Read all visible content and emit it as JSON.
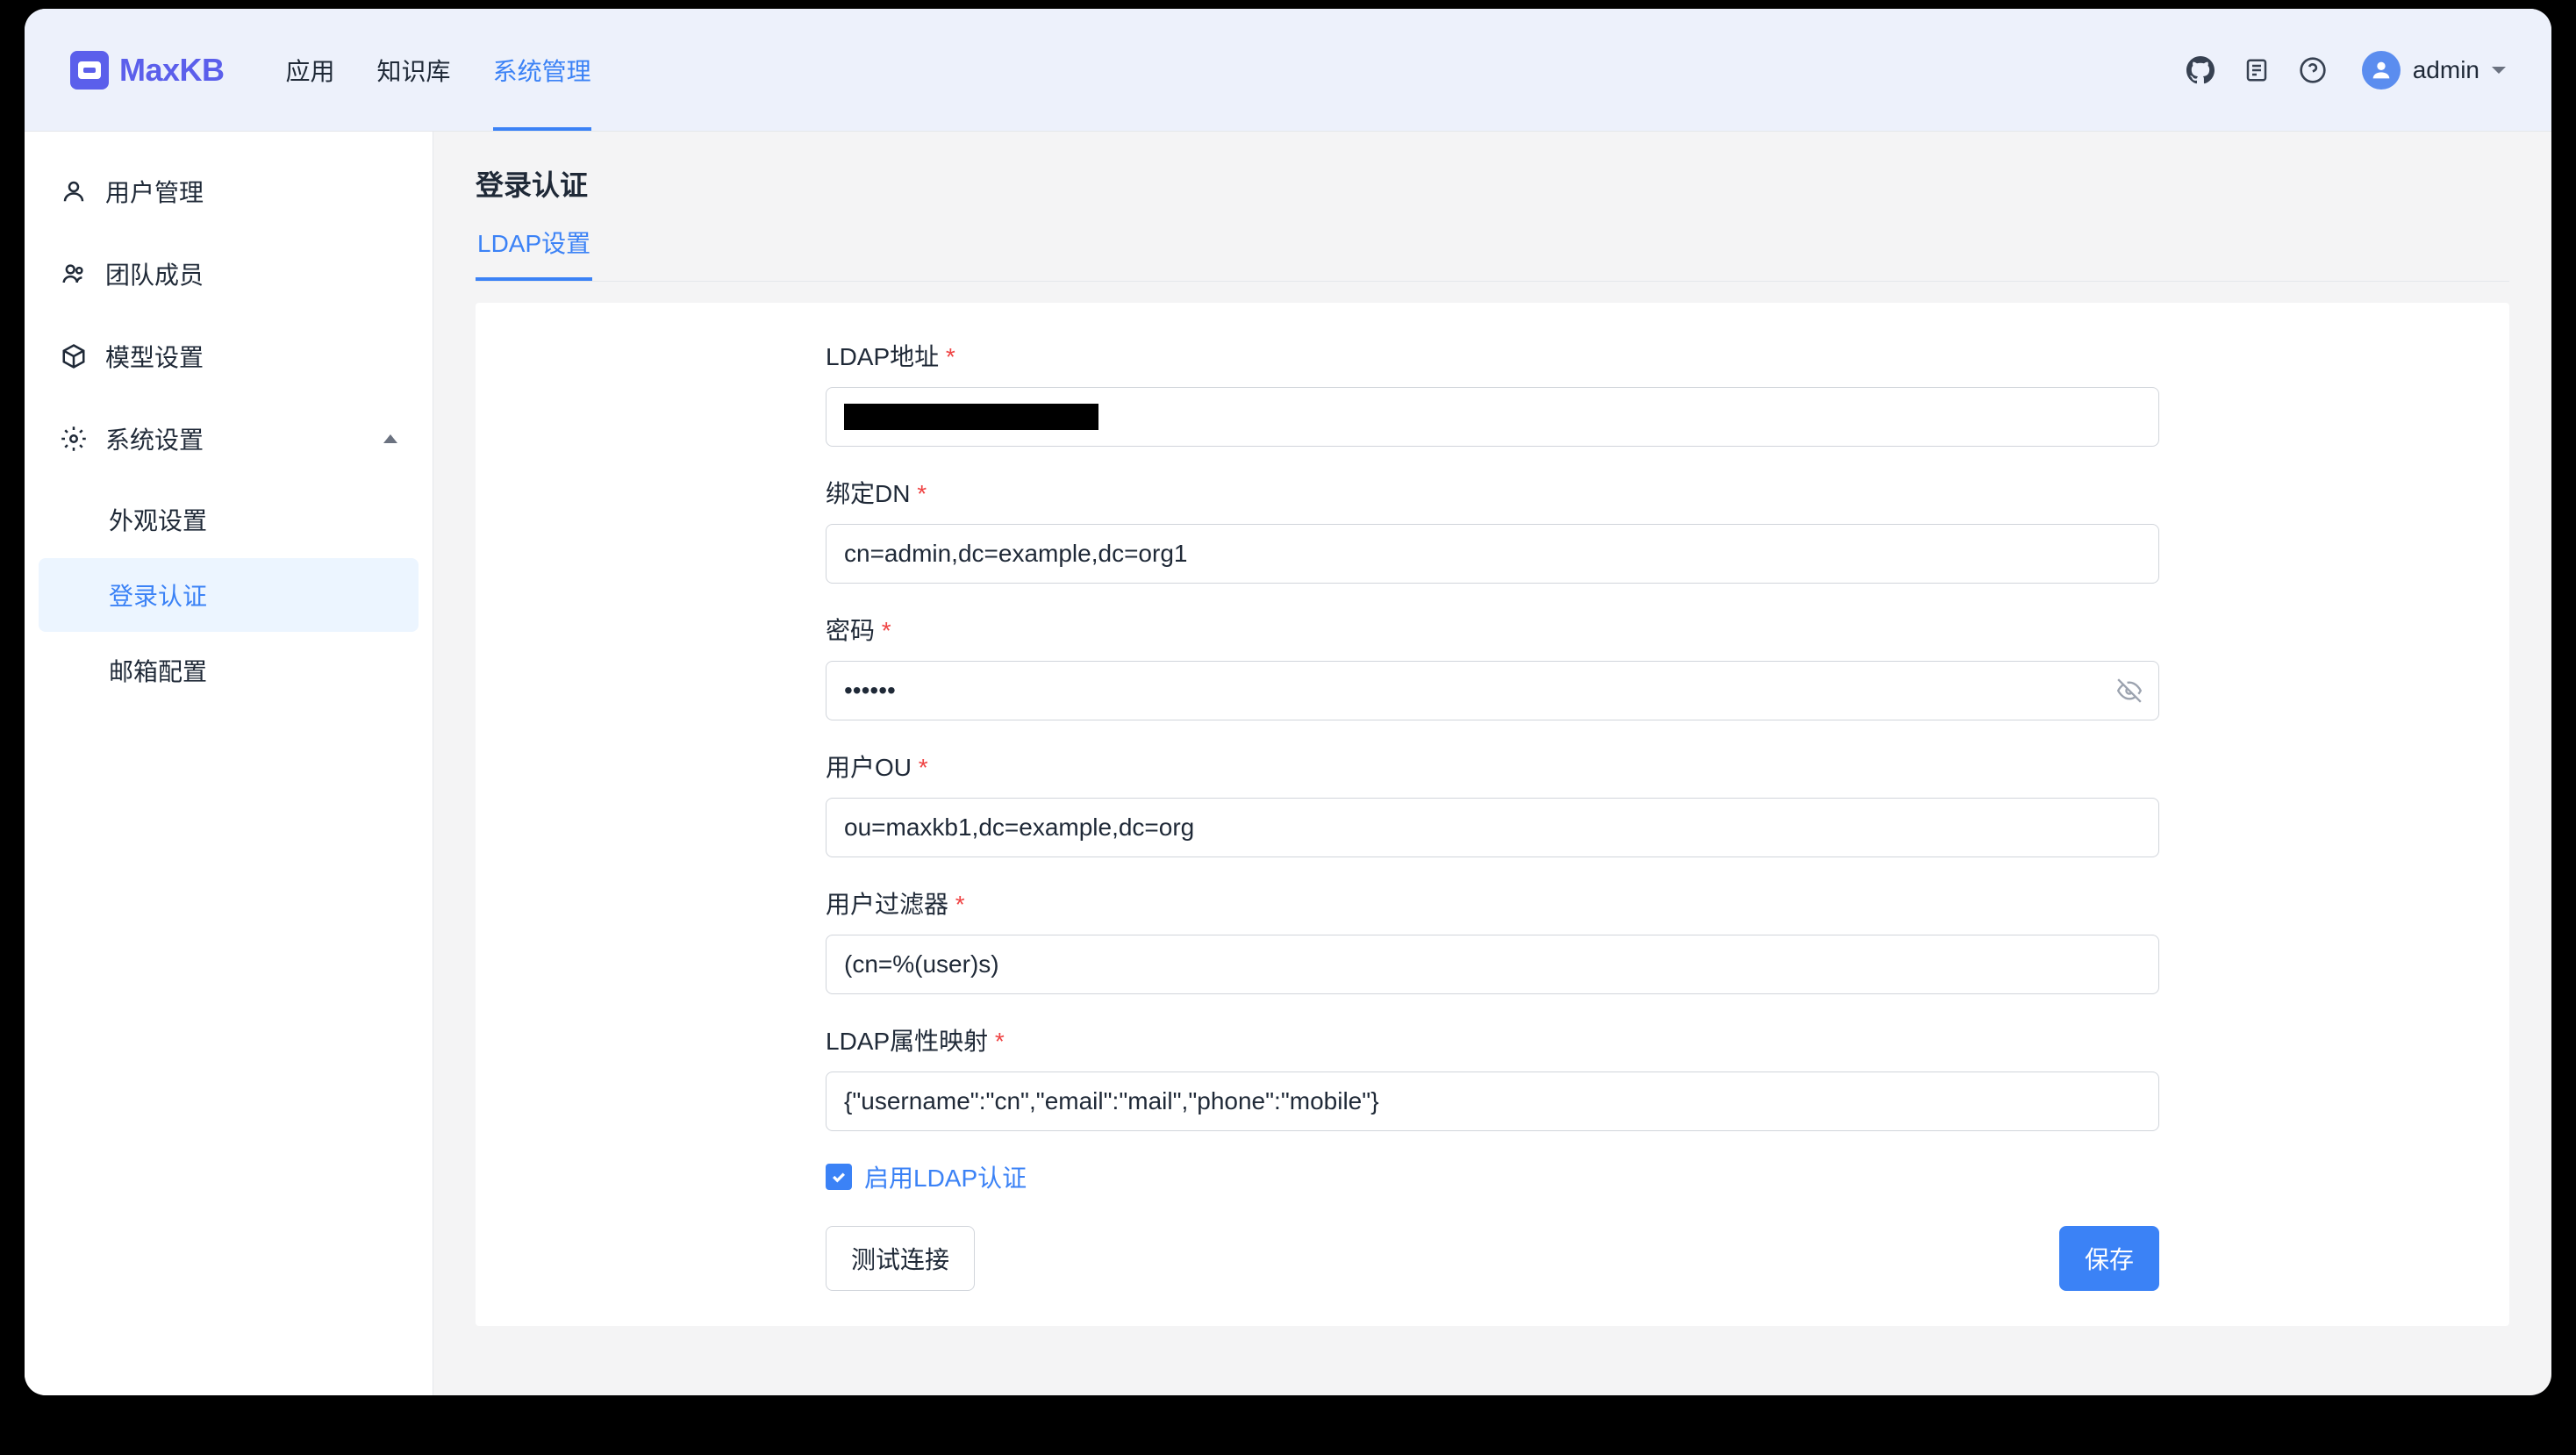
{
  "header": {
    "logo": "MaxKB",
    "nav": [
      {
        "label": "应用",
        "active": false
      },
      {
        "label": "知识库",
        "active": false
      },
      {
        "label": "系统管理",
        "active": true
      }
    ],
    "username": "admin"
  },
  "sidebar": {
    "items": [
      {
        "label": "用户管理",
        "icon": "user"
      },
      {
        "label": "团队成员",
        "icon": "users"
      },
      {
        "label": "模型设置",
        "icon": "cube"
      },
      {
        "label": "系统设置",
        "icon": "gear",
        "expanded": true,
        "children": [
          {
            "label": "外观设置",
            "active": false
          },
          {
            "label": "登录认证",
            "active": true
          },
          {
            "label": "邮箱配置",
            "active": false
          }
        ]
      }
    ]
  },
  "main": {
    "title": "登录认证",
    "tab": "LDAP设置",
    "form": {
      "ldap_address": {
        "label": "LDAP地址",
        "value": "[REDACTED]"
      },
      "bind_dn": {
        "label": "绑定DN",
        "value": "cn=admin,dc=example,dc=org1"
      },
      "password": {
        "label": "密码",
        "value": "••••••"
      },
      "user_ou": {
        "label": "用户OU",
        "value": "ou=maxkb1,dc=example,dc=org"
      },
      "user_filter": {
        "label": "用户过滤器",
        "value": "(cn=%(user)s)"
      },
      "ldap_mapping": {
        "label": "LDAP属性映射",
        "value": "{\"username\":\"cn\",\"email\":\"mail\",\"phone\":\"mobile\"}"
      },
      "enable_ldap": {
        "label": "启用LDAP认证",
        "checked": true
      },
      "test_button": "测试连接",
      "save_button": "保存"
    }
  }
}
